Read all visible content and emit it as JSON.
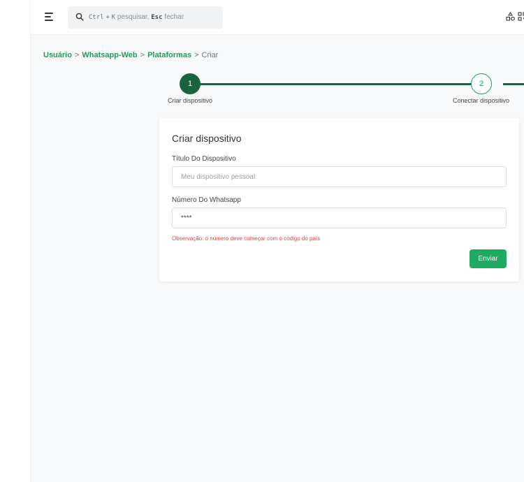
{
  "search": {
    "key1": "Ctrl",
    "plus": "+",
    "key2": "K",
    "action1": "pesquisar,",
    "key3": "Esc",
    "action2": "fechar"
  },
  "breadcrumb": {
    "items": [
      "Usuário",
      "Whatsapp-Web",
      "Plataformas"
    ],
    "separator": ">",
    "current": "Criar"
  },
  "stepper": {
    "steps": [
      {
        "number": "1",
        "label": "Criar dispositivo",
        "state": "active"
      },
      {
        "number": "2",
        "label": "Conectar dispositivo",
        "state": "pending"
      }
    ]
  },
  "form": {
    "title": "Criar dispositivo",
    "device_title_label": "Título Do Dispositivo",
    "device_title_placeholder": "Meu dispositivo pessoal",
    "device_title_value": "",
    "whatsapp_label": "Número Do Whatsapp",
    "whatsapp_value": "****",
    "note": "Observação: o número deve começar com o código do país",
    "submit_label": "Enviar"
  },
  "colors": {
    "primary": "#1e9c5b",
    "stepper_dark": "#17643f",
    "button": "#1faa61",
    "error": "#e03e3e"
  },
  "icons": {
    "menu": "menu-toggle-icon",
    "search": "search-icon",
    "top_right": [
      "apps-icon",
      "qr-code-icon"
    ]
  }
}
